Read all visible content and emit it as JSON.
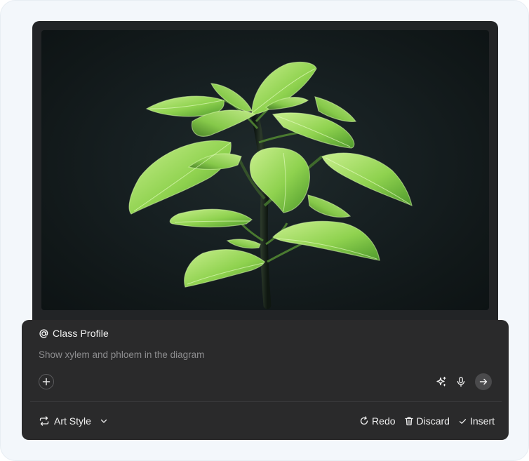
{
  "mention": {
    "label": "Class Profile",
    "icon": "at-sign-icon"
  },
  "prompt": {
    "value": "Show xylem and phloem in the diagram"
  },
  "composer_icons": {
    "add": "plus-icon",
    "enhance": "sparkles-icon",
    "voice": "microphone-icon",
    "send": "arrow-right-icon"
  },
  "footer": {
    "style_label": "Art Style",
    "redo_label": "Redo",
    "discard_label": "Discard",
    "insert_label": "Insert"
  },
  "colors": {
    "composer_bg": "#2a2a2b",
    "panel_bg": "#222426",
    "page_bg": "#f3f7fb",
    "leaf_green": "#9ed964"
  }
}
